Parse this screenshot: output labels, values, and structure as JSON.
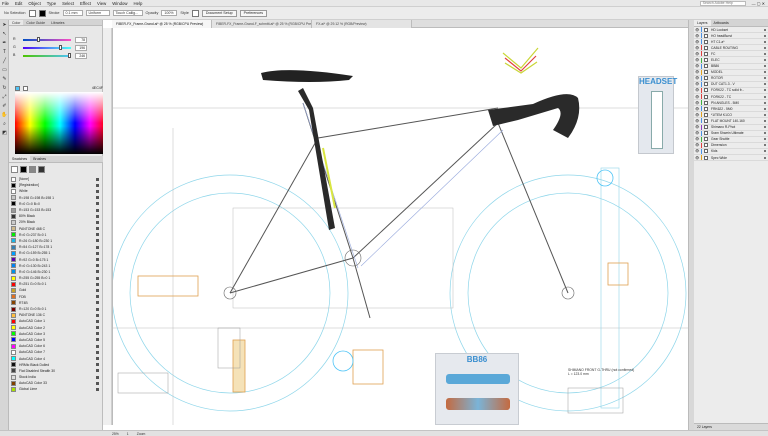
{
  "menubar": {
    "items": [
      "File",
      "Edit",
      "Object",
      "Type",
      "Select",
      "Effect",
      "View",
      "Window",
      "Help"
    ],
    "search_placeholder": "Search Adobe Help"
  },
  "control": {
    "no_selection": "No Selection",
    "stroke_label": "Stroke",
    "stroke_value": "0.1 mm",
    "brush": "Uniform",
    "style_label": "Touch Callig...",
    "opacity_label": "Opacity",
    "opacity_value": "100%",
    "style2": "Style",
    "doc_setup": "Document Setup",
    "preferences": "Preferences"
  },
  "tabs": [
    "FIBER-FX_Frame-Grand.ai* @ 25 % (RGB/CPU Preview)",
    "FIBER-FX_Frame-Grand-F_schmitt.ai* @ 25 % (RGB/CPU Preview)",
    "FX.ai* @ 29.12 % (RGB/Preview)"
  ],
  "color_panel": {
    "tabs": [
      "Color",
      "Color Guide",
      "Libraries"
    ],
    "sliders": [
      {
        "k": "R",
        "value": "78",
        "color": "#d44"
      },
      {
        "k": "G",
        "value": "196",
        "color": "#4a4"
      },
      {
        "k": "B",
        "value": "246",
        "color": "#44d"
      }
    ],
    "hex": "4EC4F6"
  },
  "swatches_panel": {
    "tabs": [
      "Swatches",
      "Brushes"
    ],
    "items": [
      {
        "name": "[None]",
        "color": "#ffffff"
      },
      {
        "name": "[Registration]",
        "color": "#000000"
      },
      {
        "name": "White",
        "color": "#ffffff"
      },
      {
        "name": "R=198 G=198 B=198 1",
        "color": "#c6c6c6"
      },
      {
        "name": "R=0 G=0 B=0",
        "color": "#000000"
      },
      {
        "name": "R=153 G=153 B=153",
        "color": "#999999"
      },
      {
        "name": "80% Black",
        "color": "#333333"
      },
      {
        "name": "20% Black",
        "color": "#cccccc"
      },
      {
        "name": "PANTONE 468 C",
        "color": "#cdb88a"
      },
      {
        "name": "R=0 G=237 B=0 1",
        "color": "#00ed00"
      },
      {
        "name": "R=26 G=180 B=230 1",
        "color": "#1ab4e6"
      },
      {
        "name": "R=54 G=127 B=178 1",
        "color": "#367fb2"
      },
      {
        "name": "R=0 G=159 B=255 1",
        "color": "#009fff"
      },
      {
        "name": "R=92 G=0 B=175 1",
        "color": "#5c00af"
      },
      {
        "name": "R=0 G=130 B=243 1",
        "color": "#0082f3"
      },
      {
        "name": "R=0 G=146 B=230 1",
        "color": "#0092e6"
      },
      {
        "name": "R=255 G=255 B=0 1",
        "color": "#ffff00"
      },
      {
        "name": "R=251 G=0 B=0 1",
        "color": "#fb0000"
      },
      {
        "name": "Gold",
        "color": "#c9a227"
      },
      {
        "name": "FDB",
        "color": "#e07020"
      },
      {
        "name": "RT4B",
        "color": "#884400"
      },
      {
        "name": "R=120 G=0 B=0 1",
        "color": "#780000"
      },
      {
        "name": "PANTONE 136 C",
        "color": "#ffbe3f"
      },
      {
        "name": "AutoCAD Color 1",
        "color": "#ff0000"
      },
      {
        "name": "AutoCAD Color 2",
        "color": "#ffff00"
      },
      {
        "name": "AutoCAD Color 3",
        "color": "#00ff00"
      },
      {
        "name": "AutoCAD Color 5",
        "color": "#0000ff"
      },
      {
        "name": "AutoCAD Color 6",
        "color": "#ff00ff"
      },
      {
        "name": "AutoCAD Color 7",
        "color": "#ffffff"
      },
      {
        "name": "AutoCAD Color 4",
        "color": "#00ffff"
      },
      {
        "name": "HRMtc Black Dulled",
        "color": "#111111"
      },
      {
        "name": "Flat Disabled Stealth 30",
        "color": "#444444"
      },
      {
        "name": "Stock India",
        "color": "#dddddd"
      },
      {
        "name": "AutoCAD Color 33",
        "color": "#7f3f00"
      },
      {
        "name": "Global Lime",
        "color": "#a8e000"
      }
    ]
  },
  "layers_panel": {
    "tabs": [
      "Layers",
      "Artboards"
    ],
    "items": [
      {
        "name": "HD Lockset",
        "color": "#4a90e2"
      },
      {
        "name": "HO headBurst",
        "color": "#4a90e2"
      },
      {
        "name": "HT C1.a*",
        "color": "#4a90e2"
      },
      {
        "name": "CABLE ROUTING",
        "color": "#e04040"
      },
      {
        "name": "FC",
        "color": "#e04040"
      },
      {
        "name": "ELEC",
        "color": "#40b040"
      },
      {
        "name": "BB86",
        "color": "#4a90e2"
      },
      {
        "name": "MODEL",
        "color": "#e0a020"
      },
      {
        "name": "ROTOR",
        "color": "#4a90e2"
      },
      {
        "name": "DUT CAT1.3 - V",
        "color": "#4a90e2"
      },
      {
        "name": "FORK22 - TC solid fr...",
        "color": "#e04040"
      },
      {
        "name": "FORK22 - TC",
        "color": "#e04040"
      },
      {
        "name": "PN ANGLES - 5M0",
        "color": "#40b040"
      },
      {
        "name": "FRK622 - 5M0",
        "color": "#4a90e2"
      },
      {
        "name": "*1ITEM K1CO",
        "color": "#e0a020"
      },
      {
        "name": "FLAT MOUNT 140-160",
        "color": "#4a90e2"
      },
      {
        "name": "Shimano R-Phot",
        "color": "#9040c0"
      },
      {
        "name": "Sram Shwein Ultimate",
        "color": "#4a90e2"
      },
      {
        "name": "Gear Shuttle",
        "color": "#40b040"
      },
      {
        "name": "Dimension",
        "color": "#e04040"
      },
      {
        "name": "Kids",
        "color": "#4a90e2"
      },
      {
        "name": "Spec Wide",
        "color": "#e0a020"
      }
    ],
    "footer": "22 Layers"
  },
  "canvas": {
    "headset_label": "HEADSET",
    "bb_label": "BB86",
    "shimano_note": "SHIMANO FRONT G-THRU (not confirmed)",
    "shimano_dim": "L = 123.0 mm"
  },
  "status": {
    "zoom": "25%",
    "artboard": "1",
    "tool": "Zoom"
  }
}
